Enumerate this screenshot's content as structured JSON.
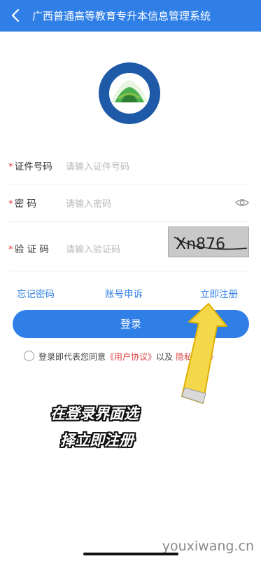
{
  "header": {
    "title": "广西普通高等教育专升本信息管理系统"
  },
  "form": {
    "id_label": "证件号码",
    "id_placeholder": "请输入证件号码",
    "password_label": "密 码",
    "password_placeholder": "请输入密码",
    "captcha_label": "验 证 码",
    "captcha_placeholder": "请输入验证码",
    "captcha_text": "Xn876",
    "required_mark": "*"
  },
  "links": {
    "forgot": "忘记密码",
    "appeal": "账号申诉",
    "register": "立即注册"
  },
  "login_button": "登录",
  "agreement": {
    "prefix": "登录即代表您同意",
    "user_agreement": "《用户协议》",
    "and": "以及",
    "privacy": "隐私政策》"
  },
  "overlay": {
    "caption_line1": "在登录界面选",
    "caption_line2": "择立即注册"
  },
  "watermark": "youxiwang.cn",
  "colors": {
    "primary": "#2f7fe6",
    "required": "#e23b3b",
    "arrow": "#f5d84a"
  }
}
